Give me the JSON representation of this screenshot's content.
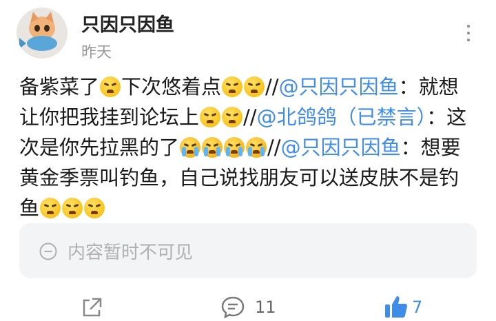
{
  "post": {
    "username": "只因只因鱼",
    "timestamp": "昨天",
    "segments": [
      {
        "t": "text",
        "v": "备紫菜了"
      },
      {
        "t": "emoji",
        "kind": "tired"
      },
      {
        "t": "text",
        "v": "下次悠着点"
      },
      {
        "t": "emoji",
        "kind": "triumph"
      },
      {
        "t": "emoji",
        "kind": "triumph"
      },
      {
        "t": "text",
        "v": "//"
      },
      {
        "t": "mention",
        "v": "@只因只因鱼"
      },
      {
        "t": "text",
        "v": "：就想让你把我挂到论坛上"
      },
      {
        "t": "emoji",
        "kind": "tired"
      },
      {
        "t": "emoji",
        "kind": "tired"
      },
      {
        "t": "text",
        "v": "//"
      },
      {
        "t": "mention",
        "v": "@北鸽鸽（已禁言）"
      },
      {
        "t": "text",
        "v": "：这次是你先拉黑的了"
      },
      {
        "t": "emoji",
        "kind": "cry"
      },
      {
        "t": "emoji",
        "kind": "cry"
      },
      {
        "t": "emoji",
        "kind": "cry"
      },
      {
        "t": "emoji",
        "kind": "cry"
      },
      {
        "t": "text",
        "v": "//"
      },
      {
        "t": "mention",
        "v": "@只因只因鱼"
      },
      {
        "t": "text",
        "v": "：想要黄金季票叫钓鱼，自己说找朋友可以送皮肤不是钓鱼"
      },
      {
        "t": "emoji",
        "kind": "triumph"
      },
      {
        "t": "emoji",
        "kind": "triumph"
      },
      {
        "t": "emoji",
        "kind": "triumph"
      }
    ]
  },
  "comment_box": {
    "placeholder": "内容暂时不可见",
    "icon": "minus-circle-icon"
  },
  "actions": {
    "comment_count": "11",
    "like_count": "7"
  },
  "colors": {
    "mention": "#3f8ce9",
    "like": "#3f8ce9"
  }
}
